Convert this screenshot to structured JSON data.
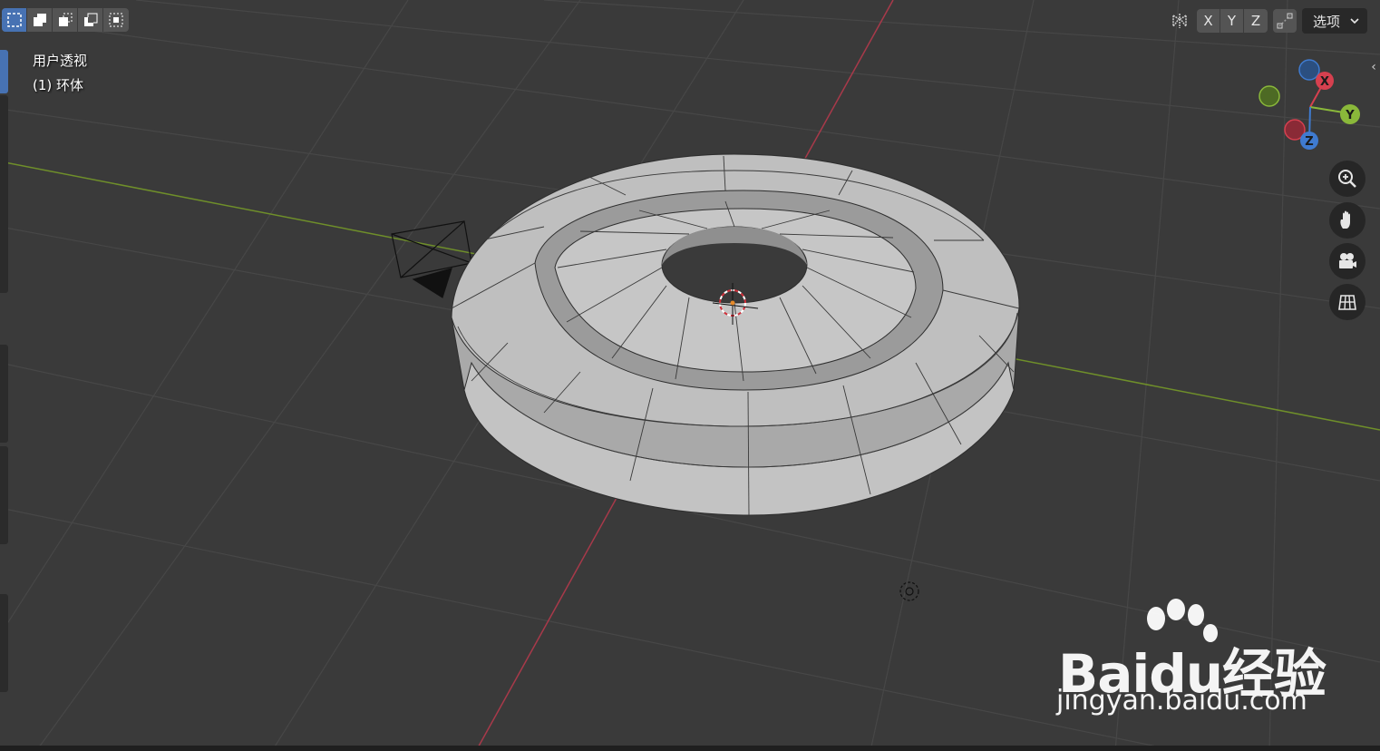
{
  "viewport": {
    "view_name": "用户透视",
    "object_name": "(1) 环体"
  },
  "header": {
    "axis_buttons": [
      "X",
      "Y",
      "Z"
    ],
    "options_label": "选项",
    "select_mode_icons": [
      "select-new-icon",
      "select-extend-icon",
      "select-subtract-icon",
      "select-difference-icon",
      "select-intersect-icon"
    ]
  },
  "gizmo": {
    "x_label": "X",
    "y_label": "Y",
    "z_label": "Z",
    "colors": {
      "x": "#d6404f",
      "y": "#8ab83a",
      "z": "#3f7bd0"
    }
  },
  "nav_buttons": [
    "zoom-icon",
    "pan-hand-icon",
    "camera-icon",
    "grid-ortho-icon"
  ],
  "watermark": {
    "brand": "Baidu经验",
    "url": "jingyan.baidu.com"
  },
  "colors": {
    "background": "#3a3a3a",
    "grid": "#4a4a4a",
    "x_axis": "#b0404a",
    "y_axis": "#7a9a2a",
    "mesh": "#bdbdbd",
    "active_mode": "#4772b3"
  }
}
